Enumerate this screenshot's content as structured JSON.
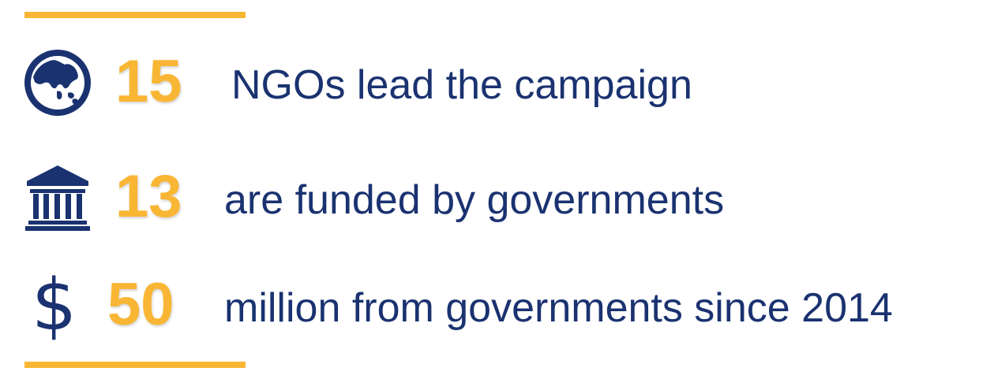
{
  "colors": {
    "accent": "#f9b634",
    "primary": "#1a3270"
  },
  "stats": [
    {
      "icon": "globe-icon",
      "number": "15",
      "text": "NGOs lead the campaign"
    },
    {
      "icon": "government-building-icon",
      "number": "13",
      "text": "are funded by governments"
    },
    {
      "icon": "dollar-icon",
      "number": "50",
      "text": "million from governments since 2014",
      "symbol": "$"
    }
  ]
}
